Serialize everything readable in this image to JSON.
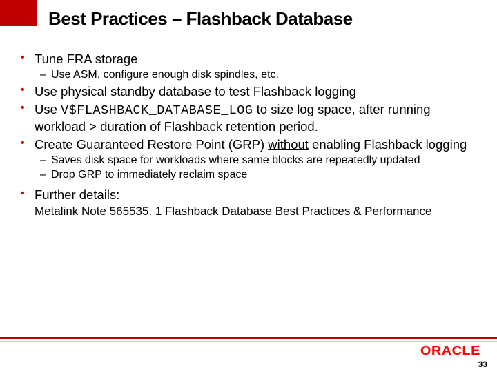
{
  "title": "Best Practices – Flashback Database",
  "bullets": {
    "b1": "Tune FRA storage",
    "b1_sub1": "Use ASM, configure enough disk spindles, etc.",
    "b2": "Use physical standby database to test Flashback logging",
    "b3_pre": "Use ",
    "b3_code": "V$FLASHBACK_DATABASE_LOG",
    "b3_post": " to size log space, after running",
    "b3_line2": "workload > duration of Flashback retention period.",
    "b4_pre": "Create Guaranteed Restore Point (GRP) ",
    "b4_under": "without",
    "b4_post": " enabling Flashback logging",
    "b4_sub1": "Saves disk space for workloads where same blocks are repeatedly updated",
    "b4_sub2": "Drop GRP to immediately reclaim space",
    "b5": "Further details:",
    "b5_note": "Metalink Note 565535. 1 Flashback Database Best Practices & Performance"
  },
  "logo": "ORACLE",
  "page_number": "33"
}
